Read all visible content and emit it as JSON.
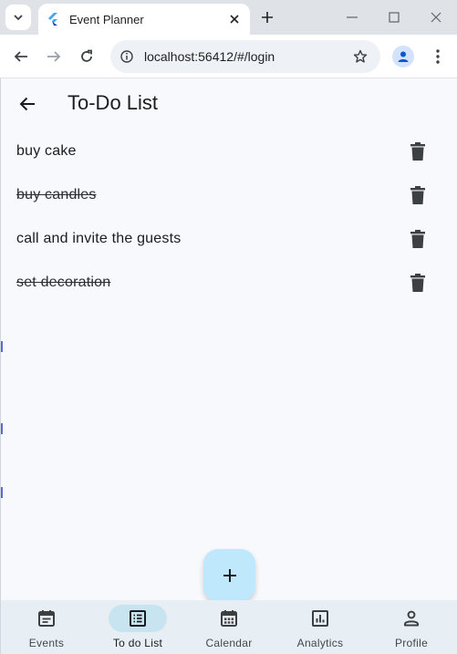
{
  "browser": {
    "tab_title": "Event Planner",
    "url": "localhost:56412/#/login",
    "icons": [
      "tab-search-icon",
      "flutter-icon",
      "close-icon",
      "plus-icon",
      "minimize-icon",
      "maximize-icon",
      "close-window-icon",
      "back-icon",
      "forward-icon",
      "reload-icon",
      "site-info-icon",
      "star-icon",
      "profile-icon",
      "more-vert-icon"
    ]
  },
  "app": {
    "title": "To-Do List",
    "todos": [
      {
        "text": "buy cake",
        "done": false
      },
      {
        "text": "buy candles",
        "done": true
      },
      {
        "text": "call and invite the guests",
        "done": false
      },
      {
        "text": "set decoration",
        "done": true
      }
    ],
    "fab_icon": "add-icon",
    "nav": [
      {
        "label": "Events",
        "icon": "event-note-icon",
        "active": false
      },
      {
        "label": "To do List",
        "icon": "list-alt-icon",
        "active": true
      },
      {
        "label": "Calendar",
        "icon": "calendar-icon",
        "active": false
      },
      {
        "label": "Analytics",
        "icon": "analytics-icon",
        "active": false
      },
      {
        "label": "Profile",
        "icon": "person-icon",
        "active": false
      }
    ]
  },
  "colors": {
    "accent": "#bfe8fd",
    "nav_background": "#e7eef4",
    "active_pill": "#c8e4f0",
    "page_background": "#f7f9fc",
    "icon": "#3c4043"
  }
}
